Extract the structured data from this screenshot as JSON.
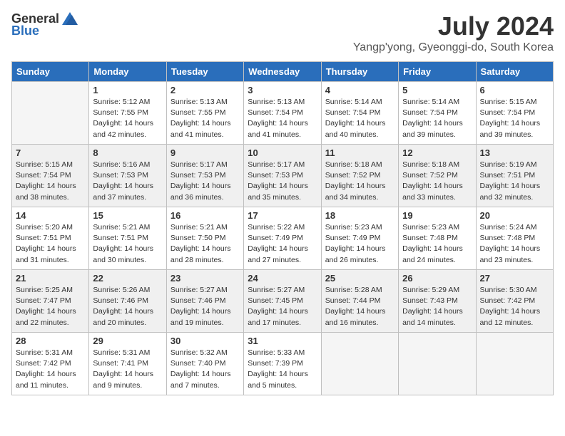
{
  "logo": {
    "general": "General",
    "blue": "Blue"
  },
  "title": "July 2024",
  "location": "Yangp'yong, Gyeonggi-do, South Korea",
  "days_header": [
    "Sunday",
    "Monday",
    "Tuesday",
    "Wednesday",
    "Thursday",
    "Friday",
    "Saturday"
  ],
  "weeks": [
    [
      {
        "day": "",
        "info": ""
      },
      {
        "day": "1",
        "info": "Sunrise: 5:12 AM\nSunset: 7:55 PM\nDaylight: 14 hours\nand 42 minutes."
      },
      {
        "day": "2",
        "info": "Sunrise: 5:13 AM\nSunset: 7:55 PM\nDaylight: 14 hours\nand 41 minutes."
      },
      {
        "day": "3",
        "info": "Sunrise: 5:13 AM\nSunset: 7:54 PM\nDaylight: 14 hours\nand 41 minutes."
      },
      {
        "day": "4",
        "info": "Sunrise: 5:14 AM\nSunset: 7:54 PM\nDaylight: 14 hours\nand 40 minutes."
      },
      {
        "day": "5",
        "info": "Sunrise: 5:14 AM\nSunset: 7:54 PM\nDaylight: 14 hours\nand 39 minutes."
      },
      {
        "day": "6",
        "info": "Sunrise: 5:15 AM\nSunset: 7:54 PM\nDaylight: 14 hours\nand 39 minutes."
      }
    ],
    [
      {
        "day": "7",
        "info": "Sunrise: 5:15 AM\nSunset: 7:54 PM\nDaylight: 14 hours\nand 38 minutes."
      },
      {
        "day": "8",
        "info": "Sunrise: 5:16 AM\nSunset: 7:53 PM\nDaylight: 14 hours\nand 37 minutes."
      },
      {
        "day": "9",
        "info": "Sunrise: 5:17 AM\nSunset: 7:53 PM\nDaylight: 14 hours\nand 36 minutes."
      },
      {
        "day": "10",
        "info": "Sunrise: 5:17 AM\nSunset: 7:53 PM\nDaylight: 14 hours\nand 35 minutes."
      },
      {
        "day": "11",
        "info": "Sunrise: 5:18 AM\nSunset: 7:52 PM\nDaylight: 14 hours\nand 34 minutes."
      },
      {
        "day": "12",
        "info": "Sunrise: 5:18 AM\nSunset: 7:52 PM\nDaylight: 14 hours\nand 33 minutes."
      },
      {
        "day": "13",
        "info": "Sunrise: 5:19 AM\nSunset: 7:51 PM\nDaylight: 14 hours\nand 32 minutes."
      }
    ],
    [
      {
        "day": "14",
        "info": "Sunrise: 5:20 AM\nSunset: 7:51 PM\nDaylight: 14 hours\nand 31 minutes."
      },
      {
        "day": "15",
        "info": "Sunrise: 5:21 AM\nSunset: 7:51 PM\nDaylight: 14 hours\nand 30 minutes."
      },
      {
        "day": "16",
        "info": "Sunrise: 5:21 AM\nSunset: 7:50 PM\nDaylight: 14 hours\nand 28 minutes."
      },
      {
        "day": "17",
        "info": "Sunrise: 5:22 AM\nSunset: 7:49 PM\nDaylight: 14 hours\nand 27 minutes."
      },
      {
        "day": "18",
        "info": "Sunrise: 5:23 AM\nSunset: 7:49 PM\nDaylight: 14 hours\nand 26 minutes."
      },
      {
        "day": "19",
        "info": "Sunrise: 5:23 AM\nSunset: 7:48 PM\nDaylight: 14 hours\nand 24 minutes."
      },
      {
        "day": "20",
        "info": "Sunrise: 5:24 AM\nSunset: 7:48 PM\nDaylight: 14 hours\nand 23 minutes."
      }
    ],
    [
      {
        "day": "21",
        "info": "Sunrise: 5:25 AM\nSunset: 7:47 PM\nDaylight: 14 hours\nand 22 minutes."
      },
      {
        "day": "22",
        "info": "Sunrise: 5:26 AM\nSunset: 7:46 PM\nDaylight: 14 hours\nand 20 minutes."
      },
      {
        "day": "23",
        "info": "Sunrise: 5:27 AM\nSunset: 7:46 PM\nDaylight: 14 hours\nand 19 minutes."
      },
      {
        "day": "24",
        "info": "Sunrise: 5:27 AM\nSunset: 7:45 PM\nDaylight: 14 hours\nand 17 minutes."
      },
      {
        "day": "25",
        "info": "Sunrise: 5:28 AM\nSunset: 7:44 PM\nDaylight: 14 hours\nand 16 minutes."
      },
      {
        "day": "26",
        "info": "Sunrise: 5:29 AM\nSunset: 7:43 PM\nDaylight: 14 hours\nand 14 minutes."
      },
      {
        "day": "27",
        "info": "Sunrise: 5:30 AM\nSunset: 7:42 PM\nDaylight: 14 hours\nand 12 minutes."
      }
    ],
    [
      {
        "day": "28",
        "info": "Sunrise: 5:31 AM\nSunset: 7:42 PM\nDaylight: 14 hours\nand 11 minutes."
      },
      {
        "day": "29",
        "info": "Sunrise: 5:31 AM\nSunset: 7:41 PM\nDaylight: 14 hours\nand 9 minutes."
      },
      {
        "day": "30",
        "info": "Sunrise: 5:32 AM\nSunset: 7:40 PM\nDaylight: 14 hours\nand 7 minutes."
      },
      {
        "day": "31",
        "info": "Sunrise: 5:33 AM\nSunset: 7:39 PM\nDaylight: 14 hours\nand 5 minutes."
      },
      {
        "day": "",
        "info": ""
      },
      {
        "day": "",
        "info": ""
      },
      {
        "day": "",
        "info": ""
      }
    ]
  ]
}
